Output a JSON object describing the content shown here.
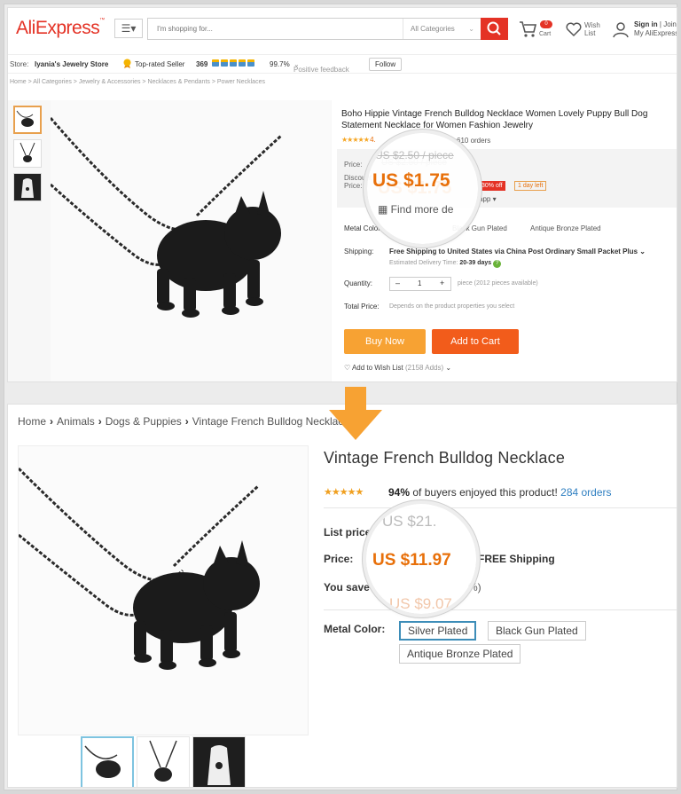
{
  "aliexpress": {
    "logo": "AliExpress",
    "search": {
      "placeholder": "I'm shopping for...",
      "categories": "All Categories"
    },
    "cart": {
      "label": "Cart",
      "count": "0"
    },
    "wish": {
      "line1": "Wish",
      "line2": "List"
    },
    "account": {
      "signin": "Sign in",
      "join": "Join",
      "my": "My AliExpress"
    },
    "store": {
      "label": "Store:",
      "name": "Iyania's Jewelry Store",
      "rated": "Top-rated Seller",
      "score": "369",
      "positive_pct": "99.7%",
      "positive_label": "Positive feedback",
      "follow": "Follow"
    },
    "breadcrumb": [
      "Home",
      "All Categories",
      "Jewelry & Accessories",
      "Necklaces & Pendants",
      "Power Necklaces"
    ],
    "product": {
      "title": "Boho Hippie Vintage French Bulldog Necklace Women Lovely Puppy Bull Dog Statement Necklace for Women Fashion Jewelry",
      "rating_text": "4.",
      "orders": "610 orders",
      "price_label": "Price:",
      "old_price": "US $2.50 / piece",
      "discount_label_1": "Discount",
      "discount_label_2": "Price:",
      "price": "US $1.75",
      "off": "30% off",
      "days_left": "1 day left",
      "app_text": "app",
      "find_more": "Find more de",
      "metal_label": "Metal Color:",
      "metal_options": [
        "Black Gun Plated",
        "Antique Bronze Plated"
      ],
      "shipping_label": "Shipping:",
      "shipping_value": "Free Shipping to United States via China Post Ordinary Small Packet Plus",
      "delivery_label": "Estimated Delivery Time:",
      "delivery_days": "20-39 days",
      "quantity_label": "Quantity:",
      "quantity": "1",
      "pieces": "piece (2012 pieces available)",
      "total_label": "Total Price:",
      "total_value": "Depends on the product properties you select",
      "buy_now": "Buy Now",
      "add_to_cart": "Add to Cart",
      "wishlist": "Add to Wish List",
      "wishlist_count": "(2158 Adds)"
    }
  },
  "shop": {
    "breadcrumb": [
      "Home",
      "Animals",
      "Dogs & Puppies",
      "Vintage French Bulldog Necklace"
    ],
    "title": "Vintage French Bulldog Necklace",
    "enjoy_pct": "94%",
    "enjoy_text": "of buyers enjoyed this product!",
    "orders": "284 orders",
    "list_price_label": "List price",
    "list_price_partial": "US $21.",
    "price_label": "Price:",
    "price": "US $11.97",
    "free_shipping": "FREE Shipping",
    "save_label": "You save",
    "save_partial": "US $9.07",
    "save_pct": "%)",
    "metal_label": "Metal Color:",
    "options": [
      "Silver Plated",
      "Black Gun Plated",
      "Antique Bronze Plated"
    ]
  },
  "colors": {
    "ali_red": "#e43225",
    "price_orange": "#e8700a",
    "link_blue": "#2f7fc1",
    "arrow_orange": "#f7a233"
  }
}
